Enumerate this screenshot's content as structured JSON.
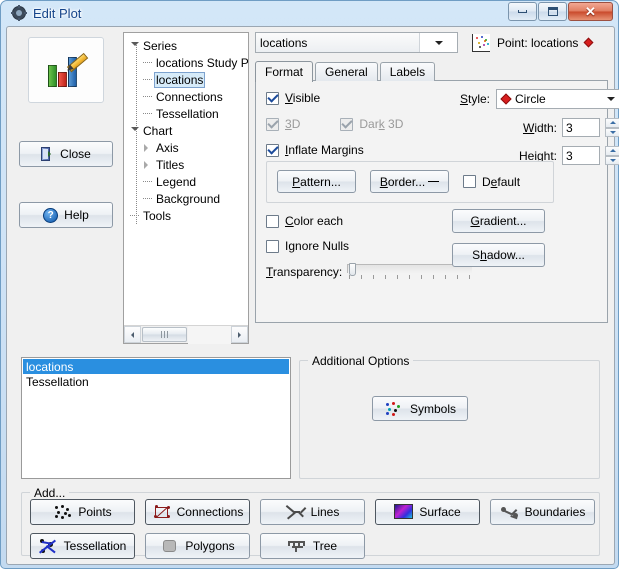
{
  "window": {
    "title": "Edit Plot",
    "icon": "app-gear-icon",
    "minimize": "–",
    "maximize": "□",
    "close": "✕"
  },
  "left_panel": {
    "preview_icon": "chart-pencil-icon",
    "close_button": "Close",
    "help_button": "Help"
  },
  "tree": {
    "nodes": [
      {
        "label": "Series",
        "depth": 0,
        "expander": "open",
        "selected": false
      },
      {
        "label": "locations Study P",
        "depth": 1,
        "expander": "none",
        "selected": false
      },
      {
        "label": "locations",
        "depth": 1,
        "expander": "none",
        "selected": true
      },
      {
        "label": "Connections",
        "depth": 1,
        "expander": "none",
        "selected": false
      },
      {
        "label": "Tessellation",
        "depth": 1,
        "expander": "none",
        "selected": false
      },
      {
        "label": "Chart",
        "depth": 0,
        "expander": "open",
        "selected": false
      },
      {
        "label": "Axis",
        "depth": 1,
        "expander": "closed",
        "selected": false
      },
      {
        "label": "Titles",
        "depth": 1,
        "expander": "closed",
        "selected": false
      },
      {
        "label": "Legend",
        "depth": 1,
        "expander": "none",
        "selected": false
      },
      {
        "label": "Background",
        "depth": 1,
        "expander": "none",
        "selected": false
      },
      {
        "label": "Tools",
        "depth": 0,
        "expander": "none",
        "selected": false
      }
    ]
  },
  "format_panel": {
    "series_combo_value": "locations",
    "point_label": "Point: locations",
    "point_marker_color": "#d81e1e",
    "tabs": [
      {
        "label": "Format",
        "active": true
      },
      {
        "label": "General",
        "active": false
      },
      {
        "label": "Labels",
        "active": false
      }
    ],
    "visible": {
      "label": "Visible",
      "checked": true,
      "enabled": true
    },
    "three_d": {
      "label": "3D",
      "checked": true,
      "enabled": false
    },
    "dark_three_d": {
      "label": "Dark 3D",
      "checked": true,
      "enabled": false
    },
    "inflate_margins": {
      "label": "Inflate Margins",
      "checked": true,
      "enabled": true
    },
    "style": {
      "label": "Style:",
      "value": "Circle",
      "marker_color": "#d81e1e"
    },
    "width": {
      "label": "Width:",
      "value": "3"
    },
    "height": {
      "label": "Height:",
      "value": "3"
    },
    "pattern_button": "Pattern...",
    "border_button": "Border...",
    "default_checkbox": {
      "label": "Default",
      "checked": false
    },
    "color_each": {
      "label": "Color each",
      "checked": false
    },
    "ignore_nulls": {
      "label": "Ignore Nulls",
      "checked": false
    },
    "transparency": {
      "label": "Transparency:",
      "value": 0
    },
    "gradient_button": "Gradient...",
    "shadow_button": "Shadow..."
  },
  "series_list": {
    "items": [
      {
        "label": "locations",
        "selected": true
      },
      {
        "label": "Tessellation",
        "selected": false
      }
    ]
  },
  "additional_options": {
    "title": "Additional Options",
    "symbols_button": "Symbols"
  },
  "add_group": {
    "title": "Add...",
    "buttons": [
      {
        "label": "Points",
        "icon": "points-icon",
        "highlighted": true
      },
      {
        "label": "Connections",
        "icon": "connections-icon",
        "highlighted": true
      },
      {
        "label": "Lines",
        "icon": "lines-icon",
        "highlighted": false
      },
      {
        "label": "Surface",
        "icon": "surface-icon",
        "highlighted": true
      },
      {
        "label": "Boundaries",
        "icon": "boundaries-icon",
        "highlighted": false
      },
      {
        "label": "Tessellation",
        "icon": "tessellation-icon",
        "highlighted": true
      },
      {
        "label": "Polygons",
        "icon": "polygons-icon",
        "highlighted": false
      },
      {
        "label": "Tree",
        "icon": "tree-icon",
        "highlighted": false
      }
    ]
  }
}
